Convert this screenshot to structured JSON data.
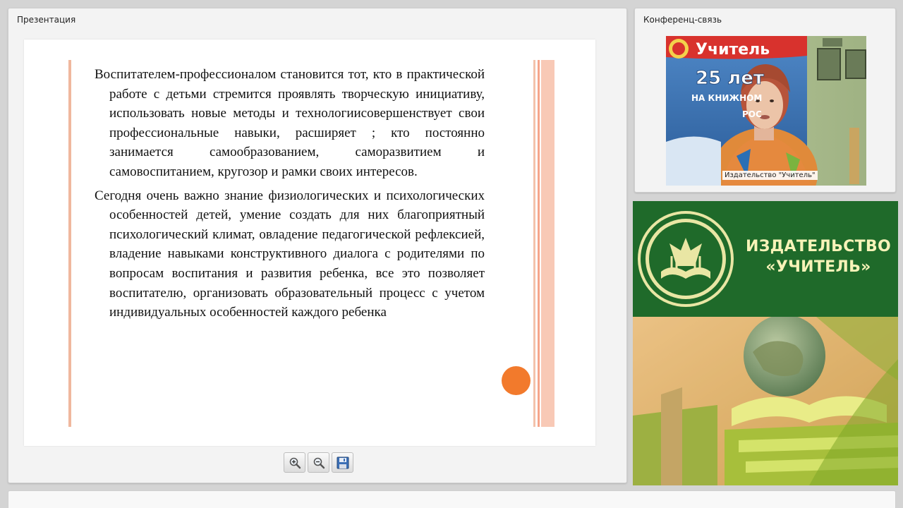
{
  "presentation": {
    "title": "Презентация",
    "slide": {
      "paragraphs": [
        "Воспитателем-профессионалом становится тот, кто в практической работе с детьми стремится проявлять творческую инициативу, использовать новые методы и технологиисовершенствует свои профессиональные навыки, расширяет ; кто постоянно занимается самообразованием, саморазвитием и самовоспитанием, кругозор и рамки своих интересов.",
        "Сегодня очень важно знание физиологических и психологических особенностей детей, умение создать для них благоприятный психологический климат, овладение педагогической рефлексией, владение навыками конструктивного диалога с родителями по вопросам воспитания и развития ребенка, все это позволяет воспитателю, организовать образовательный процесс с учетом индивидуальных особенностей каждого ребенка"
      ]
    },
    "toolbar": [
      {
        "name": "zoom-in",
        "icon": "zoom-in-icon"
      },
      {
        "name": "zoom-out",
        "icon": "zoom-out-icon"
      },
      {
        "name": "save",
        "icon": "save-icon"
      }
    ]
  },
  "conference": {
    "title": "Конференц-связь",
    "video": {
      "caption": "Издательство \"Учитель\"",
      "backdrop_brand": "Учитель",
      "backdrop_badge": "25 лет",
      "backdrop_line": "НА КНИЖНОМ",
      "backdrop_line2": "РОС"
    }
  },
  "banner": {
    "title_line1": "ИЗДАТЕЛЬСТВО",
    "title_line2": "«УЧИТЕЛЬ»"
  },
  "colors": {
    "banner_green": "#1f6a2a",
    "banner_text": "#f7f3b8",
    "slide_accent": "#f27a2c",
    "slide_stripe": "#f6a58b"
  }
}
